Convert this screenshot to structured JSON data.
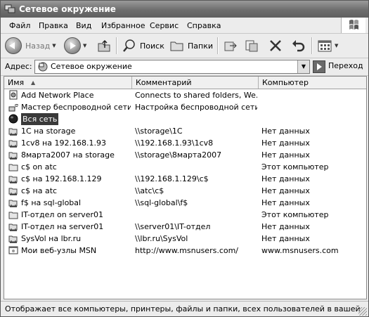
{
  "window": {
    "title": "Сетевое окружение"
  },
  "menu": [
    "Файл",
    "Правка",
    "Вид",
    "Избранное",
    "Сервис",
    "Справка"
  ],
  "toolbar": {
    "back_label": "Назад",
    "search_label": "Поиск",
    "folders_label": "Папки"
  },
  "address": {
    "label": "Адрес:",
    "value": "Сетевое окружение",
    "go_label": "Переход"
  },
  "columns": {
    "name": "Имя",
    "comment": "Комментарий",
    "computer": "Компьютер"
  },
  "rows": [
    {
      "icon": "add-network-place-icon",
      "name": "Add Network Place",
      "comment": "Connects to shared folders, We...",
      "computer": ""
    },
    {
      "icon": "wireless-network-icon",
      "name": "Мастер беспроводной сети",
      "comment": "Настройка беспроводной сети...",
      "computer": ""
    },
    {
      "icon": "entire-network-icon",
      "name": "Вся сеть",
      "comment": "",
      "computer": ""
    },
    {
      "icon": "network-share-icon",
      "name": "1С на storage",
      "comment": "\\\\storage\\1C",
      "computer": "Нет данных"
    },
    {
      "icon": "network-share-icon",
      "name": "1cv8 на 192.168.1.93",
      "comment": "\\\\192.168.1.93\\1cv8",
      "computer": "Нет данных"
    },
    {
      "icon": "network-share-icon",
      "name": "8марта2007 на storage",
      "comment": "\\\\storage\\8марта2007",
      "computer": "Нет данных"
    },
    {
      "icon": "local-folder-icon",
      "name": "c$ on atc",
      "comment": "",
      "computer": "Этот компьютер"
    },
    {
      "icon": "network-share-icon",
      "name": "c$ на 192.168.1.129",
      "comment": "\\\\192.168.1.129\\c$",
      "computer": "Нет данных"
    },
    {
      "icon": "network-share-icon",
      "name": "c$ на atc",
      "comment": "\\\\atc\\c$",
      "computer": "Нет данных"
    },
    {
      "icon": "network-share-icon",
      "name": "f$ на sql-global",
      "comment": "\\\\sql-global\\f$",
      "computer": "Нет данных"
    },
    {
      "icon": "local-folder-icon",
      "name": "IT-отдел on server01",
      "comment": "",
      "computer": "Этот компьютер"
    },
    {
      "icon": "network-share-icon",
      "name": "IT-отдел на server01",
      "comment": "\\\\server01\\IT-отдел",
      "computer": "Нет данных"
    },
    {
      "icon": "network-share-icon",
      "name": "SysVol на lbr.ru",
      "comment": "\\\\lbr.ru\\SysVol",
      "computer": "Нет данных"
    },
    {
      "icon": "web-folder-icon",
      "name": "Мои веб-узлы MSN",
      "comment": "http://www.msnusers.com/",
      "computer": "www.msnusers.com"
    }
  ],
  "status": {
    "text": "Отображает все компьютеры, принтеры, файлы и папки, всех пользователей в вашей сети."
  }
}
